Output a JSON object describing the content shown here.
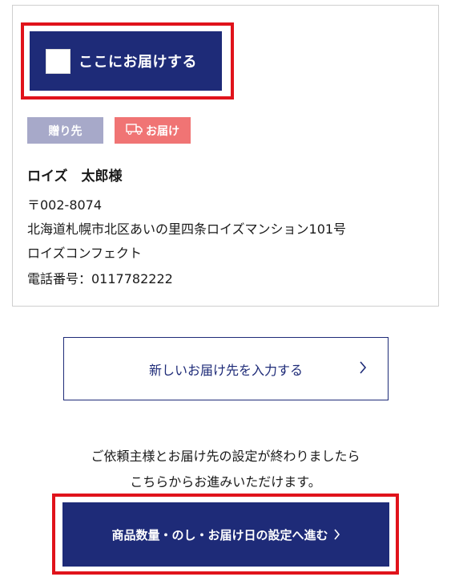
{
  "address_card": {
    "deliver_here_label": "ここにお届けする",
    "tag_recipient": "贈り先",
    "tag_delivery": "お届け",
    "name": "ロイズ　太郎様",
    "postal": "〒002-8074",
    "street": "北海道札幌市北区あいの里四条ロイズマンション101号",
    "company": "ロイズコンフェクト",
    "phone": "電話番号：0117782222"
  },
  "new_address_button": {
    "label": "新しいお届け先を入力する",
    "chevron": "chevron-right-icon"
  },
  "info": {
    "line1": "ご依頼主様とお届け先の設定が終わりましたら",
    "line2": "こちらからお進みいただけます。"
  },
  "proceed_button": {
    "label": "商品数量・のし・お届け日の設定へ進む",
    "chevron": "chevron-right-icon"
  },
  "colors": {
    "primary": "#1e2b78",
    "highlight": "#e0131b",
    "tag_recipient": "#a7a9c9",
    "tag_delivery": "#f07474"
  }
}
